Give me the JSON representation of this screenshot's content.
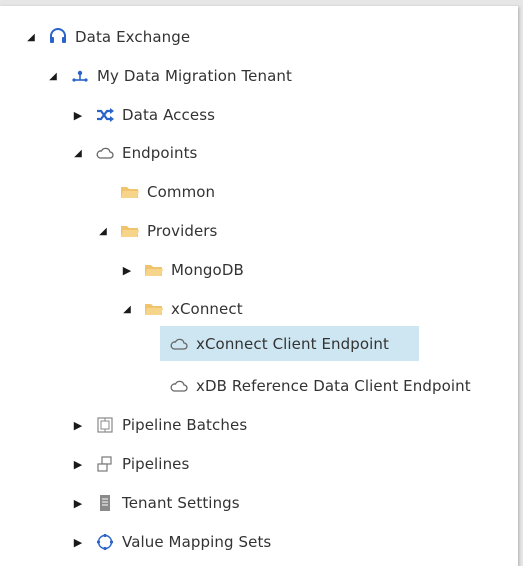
{
  "tree": {
    "root": {
      "label": "Data Exchange",
      "icon": "headset-icon"
    },
    "tenant": {
      "label": "My Data Migration Tenant",
      "icon": "tenant-icon"
    },
    "data_access": {
      "label": "Data Access",
      "icon": "shuffle-icon"
    },
    "endpoints": {
      "label": "Endpoints",
      "icon": "cloud-icon"
    },
    "common": {
      "label": "Common",
      "icon": "folder-icon"
    },
    "providers": {
      "label": "Providers",
      "icon": "folder-icon"
    },
    "mongodb": {
      "label": "MongoDB",
      "icon": "folder-icon"
    },
    "xconnect": {
      "label": "xConnect",
      "icon": "folder-icon"
    },
    "xconnect_client_endpoint": {
      "label": "xConnect Client Endpoint",
      "icon": "cloud-icon",
      "selected": true
    },
    "xdb_reference_endpoint": {
      "label": "xDB Reference Data Client Endpoint",
      "icon": "cloud-icon"
    },
    "pipeline_batches": {
      "label": "Pipeline Batches",
      "icon": "pipeline-batches-icon"
    },
    "pipelines": {
      "label": "Pipelines",
      "icon": "pipelines-icon"
    },
    "tenant_settings": {
      "label": "Tenant Settings",
      "icon": "settings-document-icon"
    },
    "value_mapping_sets": {
      "label": "Value Mapping Sets",
      "icon": "mapping-circle-icon"
    }
  },
  "colors": {
    "selection": "#cde6f2",
    "folder": "#f0c36d",
    "link_blue": "#2a63c9"
  }
}
